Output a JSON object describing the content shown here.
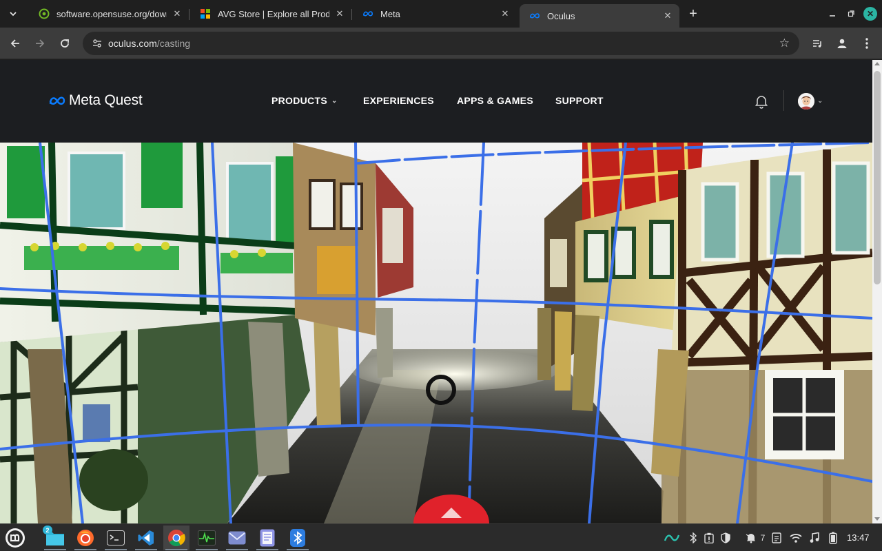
{
  "browser": {
    "tabs": [
      {
        "title": "software.opensuse.org/down",
        "favicon": "opensuse-icon",
        "active": false
      },
      {
        "title": "AVG Store | Explore all Produ",
        "favicon": "avg-icon",
        "active": false
      },
      {
        "title": "Meta",
        "favicon": "meta-icon",
        "active": false
      },
      {
        "title": "Oculus",
        "favicon": "meta-icon",
        "active": true
      }
    ],
    "url_host": "oculus.com",
    "url_path": "/casting",
    "window_controls": [
      "minimize-icon",
      "maximize-icon",
      "close-icon"
    ]
  },
  "site": {
    "logo_text": "Meta Quest",
    "nav": {
      "products": "PRODUCTS",
      "experiences": "EXPERIENCES",
      "apps_games": "APPS & GAMES",
      "support": "SUPPORT"
    }
  },
  "cast_view": {
    "description_icon": "vr-cast-stream",
    "cursor": "ring-cursor"
  },
  "taskbar": {
    "apps": [
      "menu-icon",
      "files-icon",
      "firefox-icon",
      "terminal-icon",
      "vscode-icon",
      "chrome-icon",
      "system-monitor-icon",
      "mail-icon",
      "text-editor-icon",
      "bluetooth-icon"
    ],
    "files_badge": "2",
    "notification_count": "7",
    "clock": "13:47"
  },
  "colors": {
    "chrome_bg": "#1f1f1f",
    "toolbar_bg": "#3c3c3c",
    "site_header_bg": "#1c1e21",
    "meta_blue": "#0a7cff",
    "guide_line_blue": "#3b6fe8"
  }
}
